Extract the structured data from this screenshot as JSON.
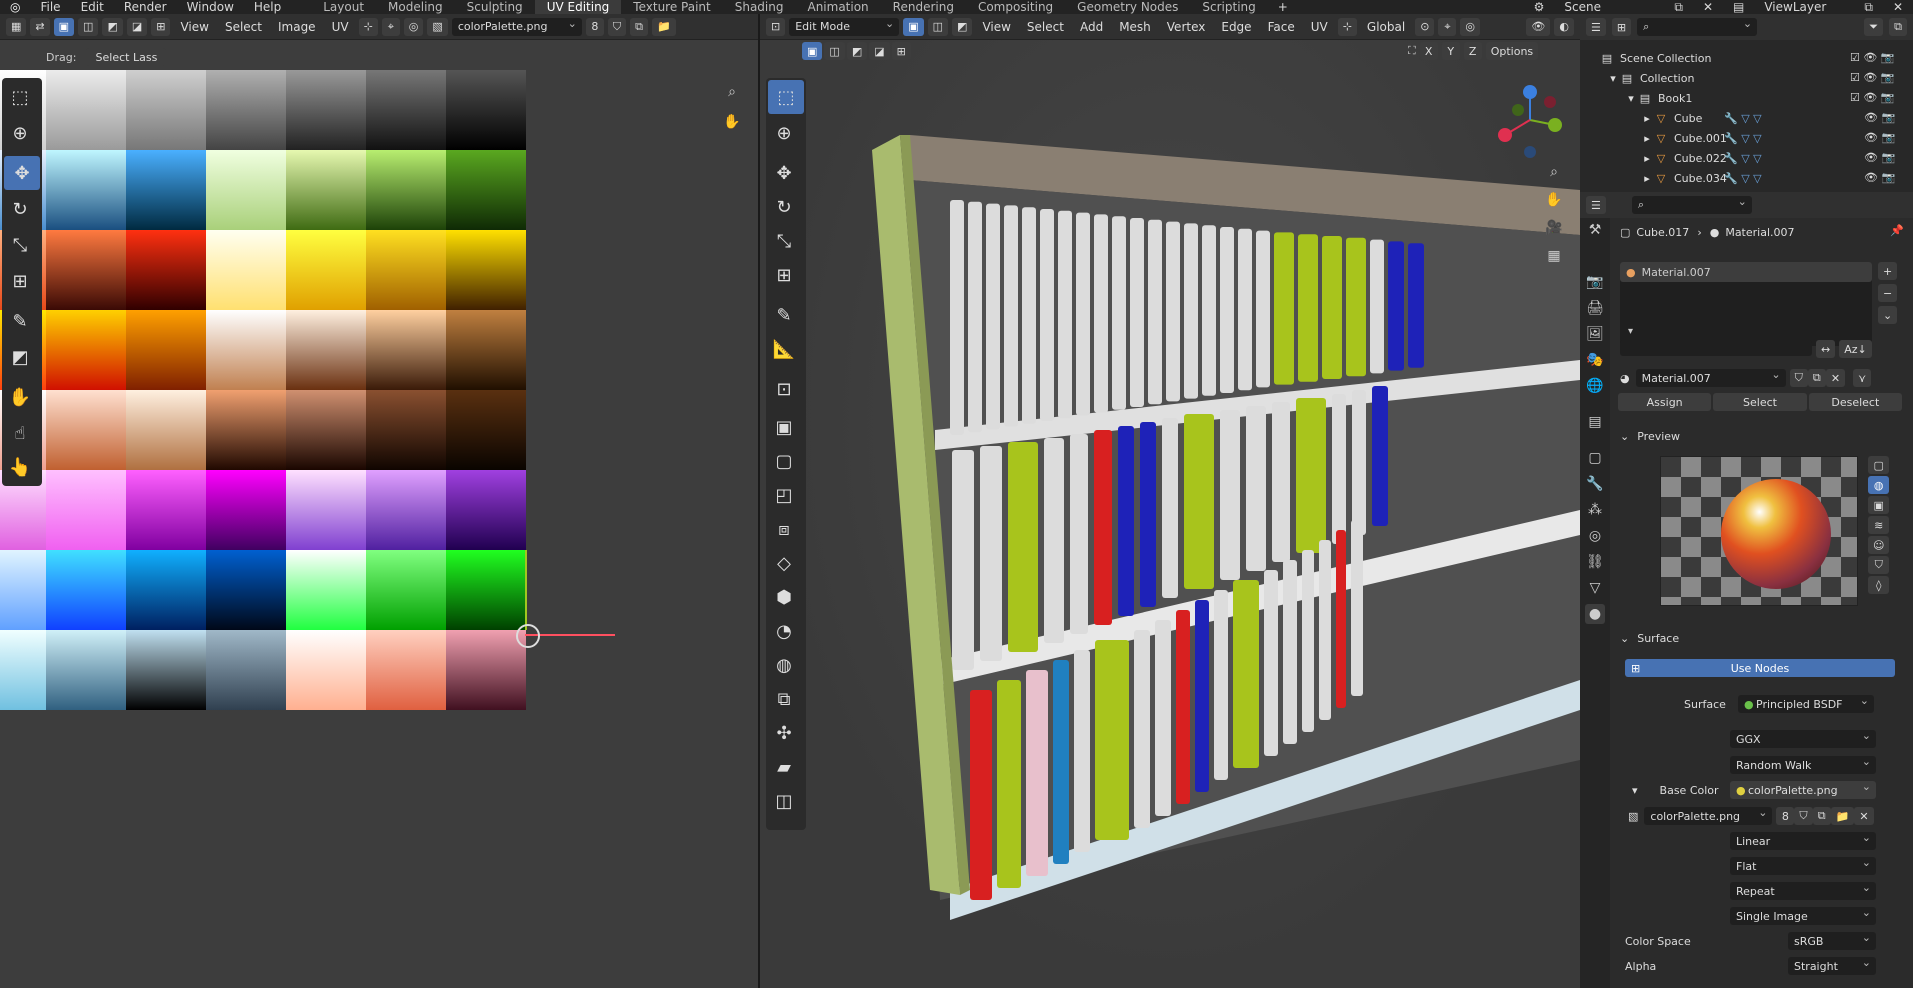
{
  "menu": {
    "items": [
      "File",
      "Edit",
      "Render",
      "Window",
      "Help"
    ],
    "workspaces": [
      "Layout",
      "Modeling",
      "Sculpting",
      "UV Editing",
      "Texture Paint",
      "Shading",
      "Animation",
      "Rendering",
      "Compositing",
      "Geometry Nodes",
      "Scripting"
    ],
    "active_workspace": "UV Editing",
    "scene": "Scene",
    "view_layer": "ViewLayer"
  },
  "uv_editor": {
    "menus": [
      "View",
      "Select",
      "Image",
      "UV"
    ],
    "image_name": "colorPalette.png",
    "users": "8",
    "drag_label": "Drag:",
    "drag_value": "Select Lass"
  },
  "viewport": {
    "mode": "Edit Mode",
    "menus": [
      "View",
      "Select",
      "Add",
      "Mesh",
      "Vertex",
      "Edge",
      "Face",
      "UV"
    ],
    "transform": "Global",
    "options": "Options",
    "axes": [
      "X",
      "Y",
      "Z"
    ]
  },
  "outliner": {
    "root": "Scene Collection",
    "collection": "Collection",
    "parent": "Book1",
    "children": [
      "Cube",
      "Cube.001",
      "Cube.022",
      "Cube.034"
    ]
  },
  "properties": {
    "breadcrumb_object": "Cube.017",
    "breadcrumb_material": "Material.007",
    "slot": "Material.007",
    "material_name": "Material.007",
    "assign": "Assign",
    "select": "Select",
    "deselect": "Deselect",
    "preview_label": "Preview",
    "surface_panel": "Surface",
    "use_nodes": "Use Nodes",
    "surface_label": "Surface",
    "surface_value": "Principled BSDF",
    "distribution": "GGX",
    "subsurface": "Random Walk",
    "base_color_label": "Base Color",
    "base_color_value": "colorPalette.png",
    "image_name": "colorPalette.png",
    "image_users": "8",
    "interpolation": "Linear",
    "projection": "Flat",
    "extension": "Repeat",
    "source": "Single Image",
    "color_space_label": "Color Space",
    "color_space_value": "sRGB",
    "alpha_label": "Alpha",
    "alpha_value": "Straight"
  },
  "palette": {
    "rows": [
      [
        [
          "#ffffff",
          "#d0d0d0"
        ],
        [
          "#ececec",
          "#9a9a9a"
        ],
        [
          "#cfcfcf",
          "#777"
        ],
        [
          "#b0b0b0",
          "#444"
        ],
        [
          "#999",
          "#222"
        ],
        [
          "#777",
          "#111"
        ],
        [
          "#555",
          "#000"
        ]
      ],
      [
        [
          "#e8f2ff",
          "#4a8fd0"
        ],
        [
          "#bff6ff",
          "#1a4f80"
        ],
        [
          "#4ab0ff",
          "#002a40"
        ],
        [
          "#f0ffe0",
          "#a9d07a"
        ],
        [
          "#e6f8b0",
          "#3f6b12"
        ],
        [
          "#b8ee70",
          "#1d4208"
        ],
        [
          "#5aa820",
          "#0f2a05"
        ]
      ],
      [
        [
          "#ffb080",
          "#e84a1a"
        ],
        [
          "#ff7a40",
          "#3a0a05"
        ],
        [
          "#ff3010",
          "#300000"
        ],
        [
          "#fffff0",
          "#ffe070"
        ],
        [
          "#ffff40",
          "#e0a000"
        ],
        [
          "#ffe020",
          "#a06000"
        ],
        [
          "#ffe000",
          "#402000"
        ]
      ],
      [
        [
          "#ffe800",
          "#ff4010"
        ],
        [
          "#ffd000",
          "#d01000"
        ],
        [
          "#ffa000",
          "#802000"
        ],
        [
          "#ffffff",
          "#c08050"
        ],
        [
          "#fff0e0",
          "#6a3010"
        ],
        [
          "#ffd0a0",
          "#3a1a08"
        ],
        [
          "#c08040",
          "#200f00"
        ]
      ],
      [
        [
          "#ffffff",
          "#f0a090"
        ],
        [
          "#ffe0d0",
          "#c06030"
        ],
        [
          "#fff0e0",
          "#b07040"
        ],
        [
          "#f0a070",
          "#200800"
        ],
        [
          "#d09070",
          "#1a0600"
        ],
        [
          "#8a5030",
          "#100500"
        ],
        [
          "#5a3010",
          "#0a0400"
        ]
      ],
      [
        [
          "#ffe0ff",
          "#e060e0"
        ],
        [
          "#ffc0ff",
          "#f060f0"
        ],
        [
          "#ff60ff",
          "#8000a0"
        ],
        [
          "#ff00ff",
          "#400060"
        ],
        [
          "#ffe0ff",
          "#8040d0"
        ],
        [
          "#e0a0ff",
          "#5020a0"
        ],
        [
          "#a040e0",
          "#200050"
        ]
      ],
      [
        [
          "#e0f4ff",
          "#60a0ff"
        ],
        [
          "#40e0ff",
          "#1040ff"
        ],
        [
          "#10b0ff",
          "#002060"
        ],
        [
          "#0060d0",
          "#000818"
        ],
        [
          "#ffffff",
          "#20ff40"
        ],
        [
          "#80ff80",
          "#00a000"
        ],
        [
          "#20ff20",
          "#004000"
        ]
      ],
      [
        [
          "#f0ffff",
          "#70c0e0"
        ],
        [
          "#d0f0f8",
          "#306080"
        ],
        [
          "#c0e0f0",
          "#000000"
        ],
        [
          "#a0b8c8",
          "#304050"
        ],
        [
          "#ffffff",
          "#ffb090"
        ],
        [
          "#ffd0c0",
          "#e06040"
        ],
        [
          "#f0a0b0",
          "#401020"
        ]
      ]
    ]
  },
  "books": {
    "colors": {
      "white": "#dcdcdc",
      "green": "#a8c41c",
      "blue": "#1e22b8",
      "red": "#d82020",
      "pink": "#e8c0cc",
      "teal": "#2080c0"
    }
  }
}
